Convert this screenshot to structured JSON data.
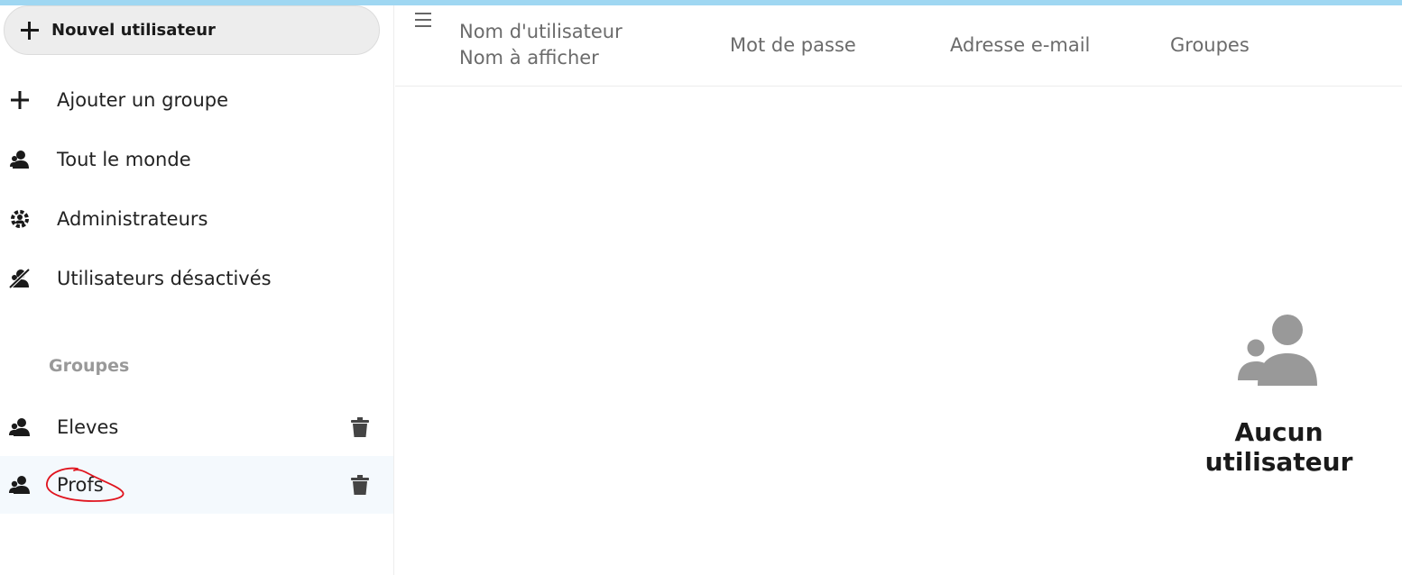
{
  "sidebar": {
    "new_user_label": "Nouvel utilisateur",
    "nav": [
      {
        "label": "Ajouter un groupe",
        "icon": "plus-icon"
      },
      {
        "label": "Tout le monde",
        "icon": "user-icon"
      },
      {
        "label": "Administrateurs",
        "icon": "user-admin-icon"
      },
      {
        "label": "Utilisateurs désactivés",
        "icon": "user-disabled-icon"
      }
    ],
    "groups_title": "Groupes",
    "groups": [
      {
        "label": "Eleves",
        "icon": "users-icon",
        "selected": false
      },
      {
        "label": "Profs",
        "icon": "users-icon",
        "selected": true
      }
    ]
  },
  "table": {
    "columns": {
      "username": "Nom d'utilisateur",
      "display_name": "Nom à afficher",
      "password": "Mot de passe",
      "email": "Adresse e-mail",
      "groups": "Groupes"
    }
  },
  "empty_state": {
    "message": "Aucun utilisateur",
    "icon": "users-icon"
  },
  "colors": {
    "top_accent": "#9fd7f2",
    "selected_row": "#f4f9fd",
    "annotation": "#e0141e"
  }
}
